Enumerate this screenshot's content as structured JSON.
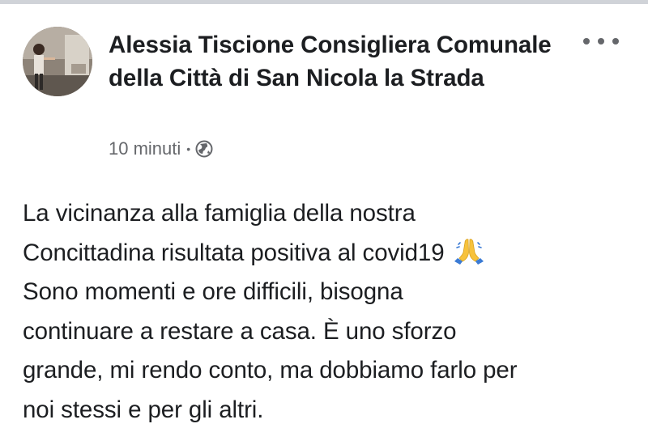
{
  "post": {
    "author": "Alessia Tiscione Consigliera Comunale della Città di San Nicola la Strada",
    "time": "10 minuti",
    "separator": "•",
    "audience_icon": "globe-icon",
    "more_icon": "more-options-icon",
    "text_lines": [
      "La vicinanza alla famiglia della nostra",
      "Concittadina risultata positiva al covid19",
      "Sono momenti e ore difficili, bisogna",
      "continuare a restare a casa. È uno sforzo",
      "grande, mi rendo conto, ma dobbiamo farlo per",
      "noi stessi e per gli altri."
    ],
    "emoji_icon": "folded-hands-emoji"
  },
  "colors": {
    "text": "#1c1e21",
    "secondary": "#65676b",
    "top_rule": "#d0d3d8",
    "emoji_skin": "#f7c23c",
    "emoji_sleeve": "#3b7bd4"
  }
}
